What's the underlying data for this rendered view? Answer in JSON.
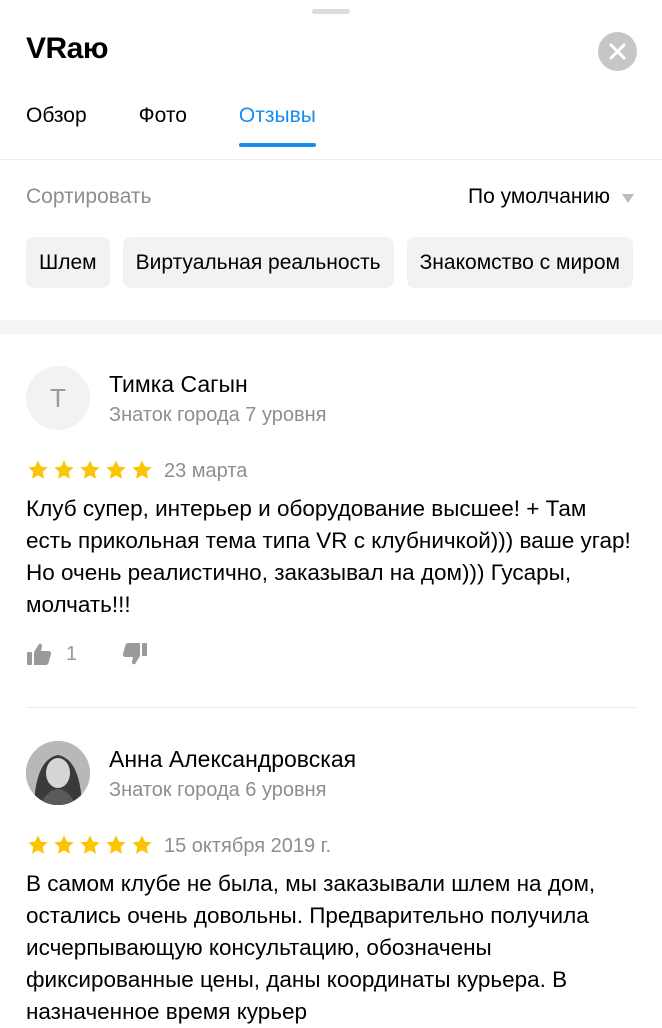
{
  "header": {
    "title": "VRаю",
    "close_icon": "close-icon"
  },
  "tabs": [
    {
      "label": "Обзор",
      "active": false
    },
    {
      "label": "Фото",
      "active": false
    },
    {
      "label": "Отзывы",
      "active": true
    }
  ],
  "sort": {
    "label": "Сортировать",
    "value": "По умолчанию",
    "icon": "caret-down-icon"
  },
  "chips": [
    "Шлем",
    "Виртуальная реальность",
    "Знакомство с миром"
  ],
  "reviews": [
    {
      "avatar_letter": "Т",
      "author": "Тимка Сагын",
      "level": "Знаток города 7 уровня",
      "rating": 5,
      "date": "23 марта",
      "text": "Клуб супер, интерьер и оборудование высшее! + Там есть прикольная тема типа VR с клубничкой))) ваше угар! Но очень реалистично, заказывал на дом))) Гусары, молчать!!!",
      "likes": "1"
    },
    {
      "avatar_letter": "",
      "author": "Анна Александровская",
      "level": "Знаток города 6 уровня",
      "rating": 5,
      "date": "15 октября 2019 г.",
      "text": "В самом клубе не была, мы заказывали шлем на дом, остались очень довольны. Предварительно получила исчерпывающую консультацию, обозначены фиксированные цены, даны координаты курьера. В назначенное время курьер"
    }
  ],
  "colors": {
    "accent": "#1a8cf0",
    "star": "#fcc503",
    "muted": "#8e8e8e"
  }
}
